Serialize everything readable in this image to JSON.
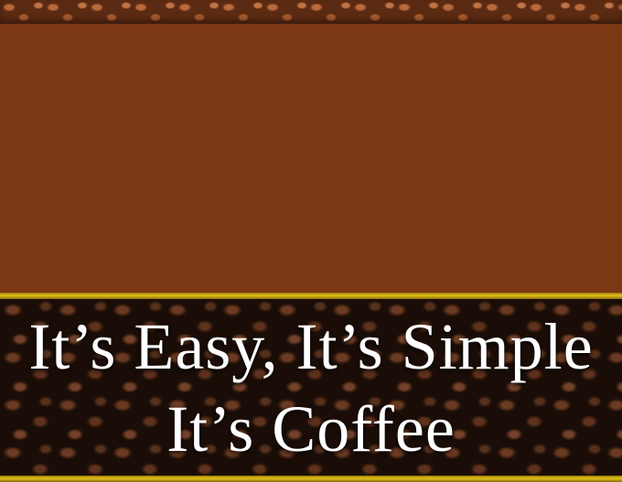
{
  "banner": {
    "line1": "It’s Easy, It’s Simple",
    "line2": "It’s Coffee"
  },
  "colors": {
    "panel": "#7c3714",
    "gold_trim": "#e2c21c",
    "banner_text": "#ffffff",
    "beans_dark": "#1a0d07"
  }
}
